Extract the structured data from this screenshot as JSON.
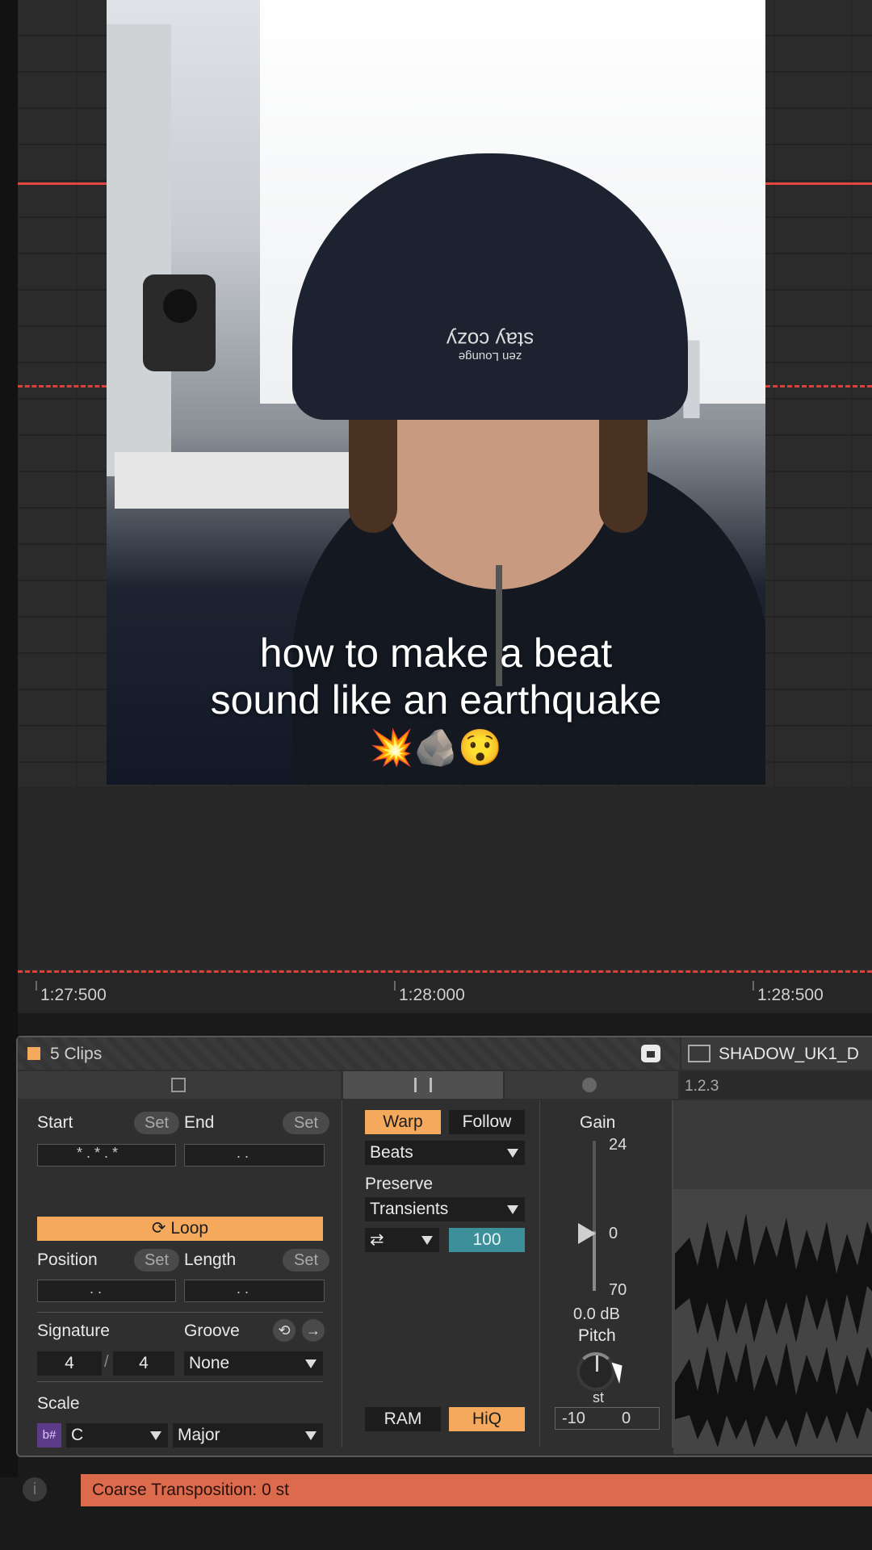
{
  "video": {
    "caption_line1": "how to make a beat",
    "caption_line2": "sound like an earthquake",
    "emoji": "💥🪨😯",
    "beanie_text": "stay cozy",
    "beanie_subtext": "zen Lounge"
  },
  "ruler": {
    "marks": [
      "1:27:500",
      "1:28:000",
      "1:28:500"
    ]
  },
  "clip": {
    "title": "5 Clips",
    "sample_name": "SHADOW_UK1_D",
    "sample_position": "1.2.3",
    "start_label": "Start",
    "end_label": "End",
    "set_label": "Set",
    "loop_label": "Loop",
    "position_label": "Position",
    "length_label": "Length",
    "signature_label": "Signature",
    "groove_label": "Groove",
    "signature_num": "4",
    "signature_den": "4",
    "groove_value": "None",
    "scale_label": "Scale",
    "scale_root": "C",
    "scale_mode": "Major",
    "start_value": "*  .  *  .  *",
    "end_value": ".  .",
    "position_value": ".  .",
    "length_value": ".  .",
    "signature_sep": "/",
    "scale_icon_text": "b#"
  },
  "warp": {
    "warp_label": "Warp",
    "follow_label": "Follow",
    "mode": "Beats",
    "preserve_label": "Preserve",
    "preserve_value": "Transients",
    "loop_mode_icon": "⇄",
    "amount": "100",
    "ram_label": "RAM",
    "hiq_label": "HiQ"
  },
  "gain": {
    "label": "Gain",
    "max": "24",
    "zero": "0",
    "min": "70",
    "value_db": "0.0 dB",
    "pitch_label": "Pitch",
    "pitch_unit": "st",
    "coarse_value": "-10",
    "fine_value": "0"
  },
  "status": {
    "message": "Coarse Transposition: 0 st",
    "info_icon": "i"
  },
  "colors": {
    "accent_orange": "#f5a95c",
    "status_red": "#dc6a4c",
    "amount_teal": "#3d8f9a"
  }
}
